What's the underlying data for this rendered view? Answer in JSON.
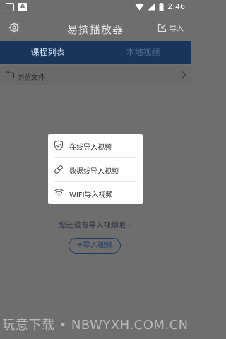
{
  "status_bar": {
    "time": "2:46",
    "notification_icon_2_letter": "A"
  },
  "toolbar": {
    "title": "易撰播放器",
    "import_label": "导入"
  },
  "tabs": [
    {
      "label": "课程列表",
      "active": true
    },
    {
      "label": "本地视频",
      "active": false
    }
  ],
  "browse": {
    "label": "浏览文件"
  },
  "popup_menu": {
    "items": [
      {
        "label": "在线导入视频",
        "icon": "shield-check-icon"
      },
      {
        "label": "数据线导入视频",
        "icon": "link-icon"
      },
      {
        "label": "WIFI导入视频",
        "icon": "wifi-icon"
      }
    ]
  },
  "empty_state": {
    "message": "您还没有导入视频哦~",
    "import_button_label": "+导入视频"
  },
  "watermark": {
    "text": "玩意下载 • NBWYXH.COM.CN"
  },
  "colors": {
    "overlay_gray": "#6e6e6e",
    "tab_bar": "#18365b",
    "accent_navy": "#1f3b64",
    "popup_bg": "#ffffff"
  }
}
